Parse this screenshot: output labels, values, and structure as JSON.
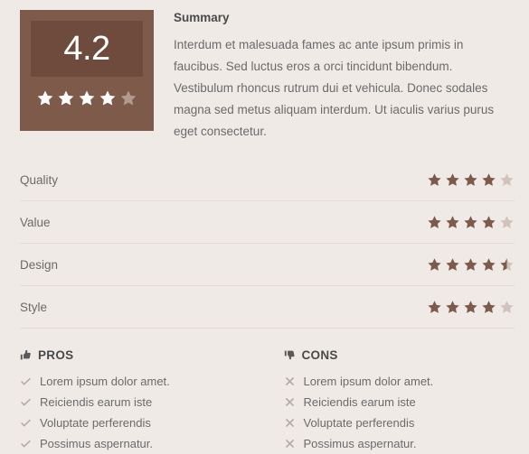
{
  "colors": {
    "background": "#efeae6",
    "score_box": "#7d5a4a",
    "score_inner": "#6e4b3c",
    "star_filled": "#7d5a4a",
    "star_empty": "#cfc4bd",
    "star_on_box": "#ffffff",
    "star_on_box_empty": "#b09b91",
    "divider": "#e4ddd7",
    "text": "#6b6b6b",
    "heading": "#4a4a4a"
  },
  "score": {
    "value": "4.2",
    "stars": 4,
    "max_stars": 5
  },
  "summary": {
    "title": "Summary",
    "text": "Interdum et malesuada fames ac ante ipsum primis in faucibus. Sed luctus eros a orci tincidunt bibendum. Vestibulum rhoncus rutrum dui et vehicula. Donec sodales magna sed metus aliquam interdum. Ut iaculis varius purus eget consectetur."
  },
  "ratings": [
    {
      "label": "Quality",
      "stars": 4
    },
    {
      "label": "Value",
      "stars": 4
    },
    {
      "label": "Design",
      "stars": 4.5
    },
    {
      "label": "Style",
      "stars": 4
    }
  ],
  "pros": {
    "title": "PROS",
    "icon": "thumbs-up-icon",
    "item_icon": "check-icon",
    "items": [
      "Lorem ipsum dolor amet.",
      "Reiciendis earum iste",
      "Voluptate perferendis",
      "Possimus aspernatur."
    ]
  },
  "cons": {
    "title": "CONS",
    "icon": "thumbs-down-icon",
    "item_icon": "cross-icon",
    "items": [
      "Lorem ipsum dolor amet.",
      "Reiciendis earum iste",
      "Voluptate perferendis",
      "Possimus aspernatur."
    ]
  }
}
